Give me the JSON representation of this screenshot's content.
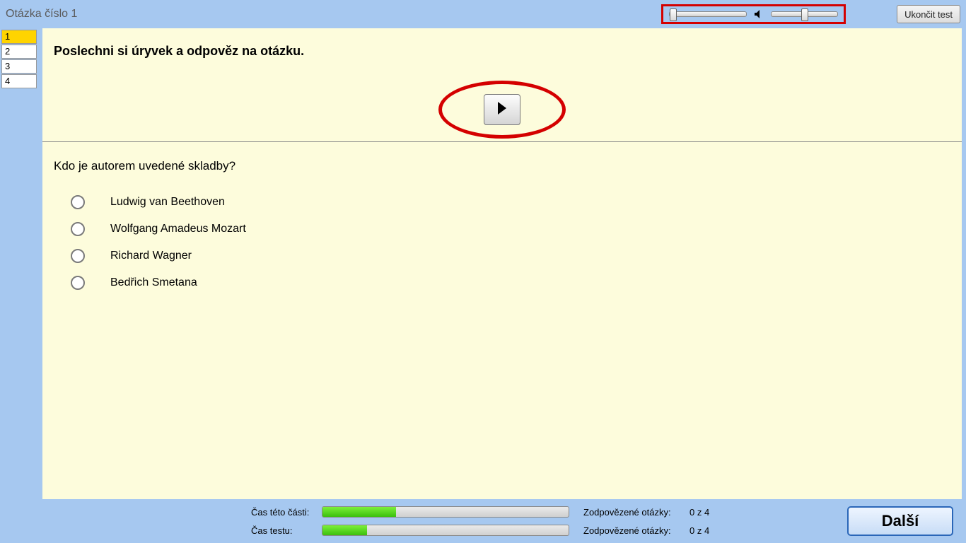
{
  "header": {
    "title": "Otázka číslo 1",
    "end_test_label": "Ukončit test",
    "audio_progress_percent": 3,
    "volume_percent": 50
  },
  "sidebar": {
    "items": [
      {
        "label": "1",
        "active": true
      },
      {
        "label": "2",
        "active": false
      },
      {
        "label": "3",
        "active": false
      },
      {
        "label": "4",
        "active": false
      }
    ]
  },
  "main": {
    "instruction": "Poslechni si úryvek a odpověz na otázku.",
    "question": "Kdo je autorem uvedené skladby?",
    "options": [
      "Ludwig van Beethoven",
      "Wolfgang Amadeus Mozart",
      "Richard Wagner",
      "Bedřich Smetana"
    ]
  },
  "footer": {
    "part_time_label": "Čas této části:",
    "test_time_label": "Čas testu:",
    "part_time_percent": 30,
    "test_time_percent": 18,
    "answered_label": "Zodpovězené otázky:",
    "answered_part_value": "0 z 4",
    "answered_test_value": "0 z 4",
    "next_label": "Další"
  }
}
